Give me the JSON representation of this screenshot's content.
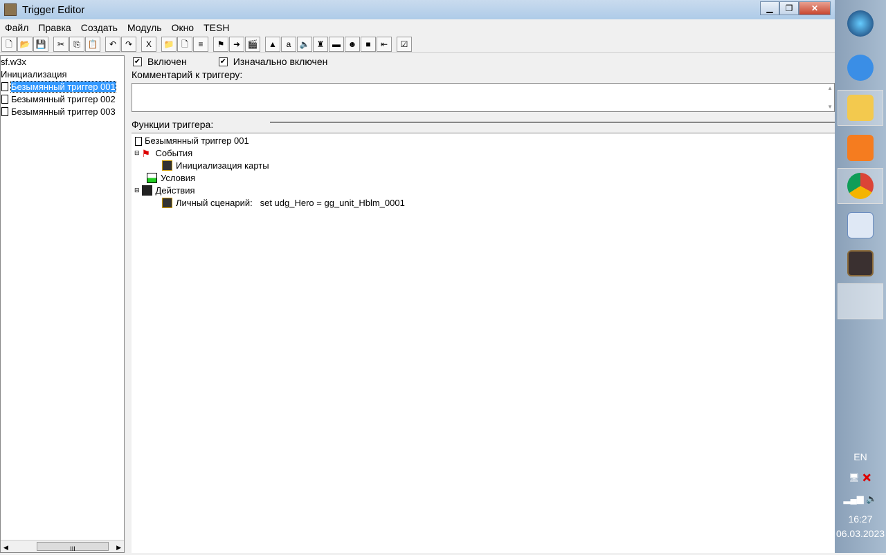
{
  "window": {
    "title": "Trigger Editor",
    "minimize": "▁",
    "restore": "❐",
    "close": "✕"
  },
  "menu": [
    "Файл",
    "Правка",
    "Создать",
    "Модуль",
    "Окно",
    "TESH"
  ],
  "toolbar": [
    "new",
    "open",
    "save",
    "cut",
    "copy",
    "paste",
    "undo",
    "redo",
    "delete",
    "folder",
    "trigger",
    "comment",
    "event",
    "condition",
    "action",
    "terrain",
    "text",
    "sound",
    "unit",
    "item",
    "ai",
    "object",
    "import",
    "test"
  ],
  "left_tree": {
    "root": "sf.w3x",
    "category": "Инициализация",
    "triggers": [
      "Безымянный триггер 001",
      "Безымянный триггер 002",
      "Безымянный триггер 003"
    ],
    "scroll_thumb": "III"
  },
  "trigger": {
    "enabled_label": "Включен",
    "initially_on_label": "Изначально включен",
    "comment_label": "Комментарий к триггеру:",
    "functions_label": "Функции триггера:"
  },
  "func_tree": {
    "name": "Безымянный триггер 001",
    "events": "События",
    "event_item": "Инициализация карты",
    "conditions": "Условия",
    "actions": "Действия",
    "action_item": "Личный сценарий:   set udg_Hero = gg_unit_Hblm_0001"
  },
  "taskbar": {
    "lang": "EN",
    "time": "16:27",
    "date": "06.03.2023"
  }
}
